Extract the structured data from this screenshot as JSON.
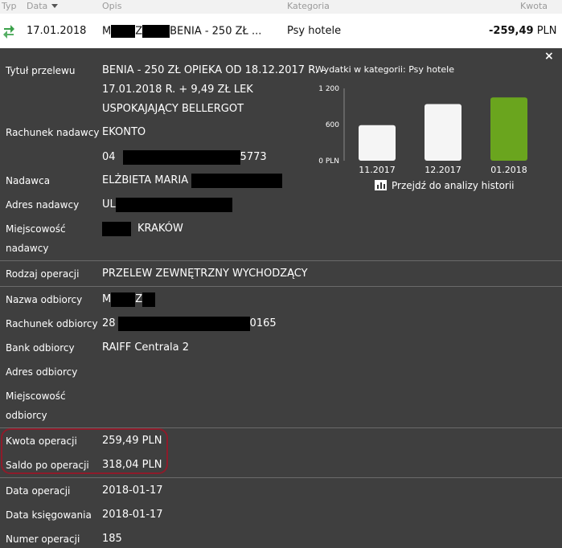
{
  "header": {
    "typ": "Typ",
    "data": "Data",
    "opis": "Opis",
    "kategoria": "Kategoria",
    "kwota": "Kwota"
  },
  "row": {
    "date": "17.01.2018",
    "desc_prefix": "M",
    "desc_mid": "Z",
    "desc_suffix": "BENIA - 250 ZŁ ...",
    "category": "Psy hotele",
    "amount": "-259,49",
    "currency": "PLN"
  },
  "close_glyph": "×",
  "details": {
    "tytul_label": "Tytuł przelewu",
    "tytul_line1": "BENIA - 250 ZŁ OPIEKA OD 18.12.2017 R. -",
    "tytul_line2": "17.01.2018 R. + 9,49 ZŁ LEK",
    "tytul_line3": "USPOKAJAJĄCY BELLERGOT",
    "rachunek_nadawcy_label": "Rachunek nadawcy",
    "rachunek_nadawcy_line1": "EKONTO",
    "rachunek_nadawcy_prefix": "04",
    "rachunek_nadawcy_suffix": "5773",
    "nadawca_label": "Nadawca",
    "nadawca_value": "ELŻBIETA MARIA",
    "adres_nadawcy_label": "Adres nadawcy",
    "adres_nadawcy_value": "UL",
    "miejscowosc_nadawcy_label1": "Miejscowość",
    "miejscowosc_nadawcy_label2": "nadawcy",
    "miejscowosc_nadawcy_value": "KRAKÓW",
    "rodzaj_label": "Rodzaj operacji",
    "rodzaj_value": "PRZELEW ZEWNĘTRZNY WYCHODZĄCY",
    "nazwa_odbiorcy_label": "Nazwa odbiorcy",
    "nazwa_odbiorcy_prefix": "M",
    "nazwa_odbiorcy_mid": "Z",
    "rachunek_odbiorcy_label": "Rachunek odbiorcy",
    "rachunek_odbiorcy_prefix": "28",
    "rachunek_odbiorcy_suffix": "0165",
    "bank_label": "Bank odbiorcy",
    "bank_value": "RAIFF Centrala 2",
    "adres_odbiorcy_label": "Adres odbiorcy",
    "miejscowosc_odbiorcy_label1": "Miejscowość",
    "miejscowosc_odbiorcy_label2": "odbiorcy",
    "kwota_label": "Kwota operacji",
    "kwota_value": "259,49 PLN",
    "saldo_label": "Saldo po operacji",
    "saldo_value": "318,04 PLN",
    "data_operacji_label": "Data operacji",
    "data_operacji_value": "2018-01-17",
    "data_ksiegowania_label": "Data księgowania",
    "data_ksiegowania_value": "2018-01-17",
    "numer_label": "Numer operacji",
    "numer_value": "185"
  },
  "chart_data": {
    "type": "bar",
    "title": "Wydatki w kategorii:  Psy hotele",
    "categories": [
      "11.2017",
      "12.2017",
      "01.2018"
    ],
    "values": [
      590,
      940,
      1050
    ],
    "ylim": [
      0,
      1200
    ],
    "yticks": [
      {
        "value": 0,
        "label": "0 PLN"
      },
      {
        "value": 600,
        "label": "600"
      },
      {
        "value": 1200,
        "label": "1 200"
      }
    ],
    "bar_colors": [
      "#f5f5f5",
      "#f5f5f5",
      "#6aa51e"
    ],
    "grid": false,
    "xlabel": "",
    "ylabel": ""
  },
  "history_link": "Przejdź do analizy historii",
  "colors": {
    "panel_bg": "#3f3f3f",
    "header_bg": "#f2f2f2",
    "highlight_border": "#8e1b2a",
    "accent_green": "#6aa51e",
    "icon_green": "#3aa14a"
  }
}
